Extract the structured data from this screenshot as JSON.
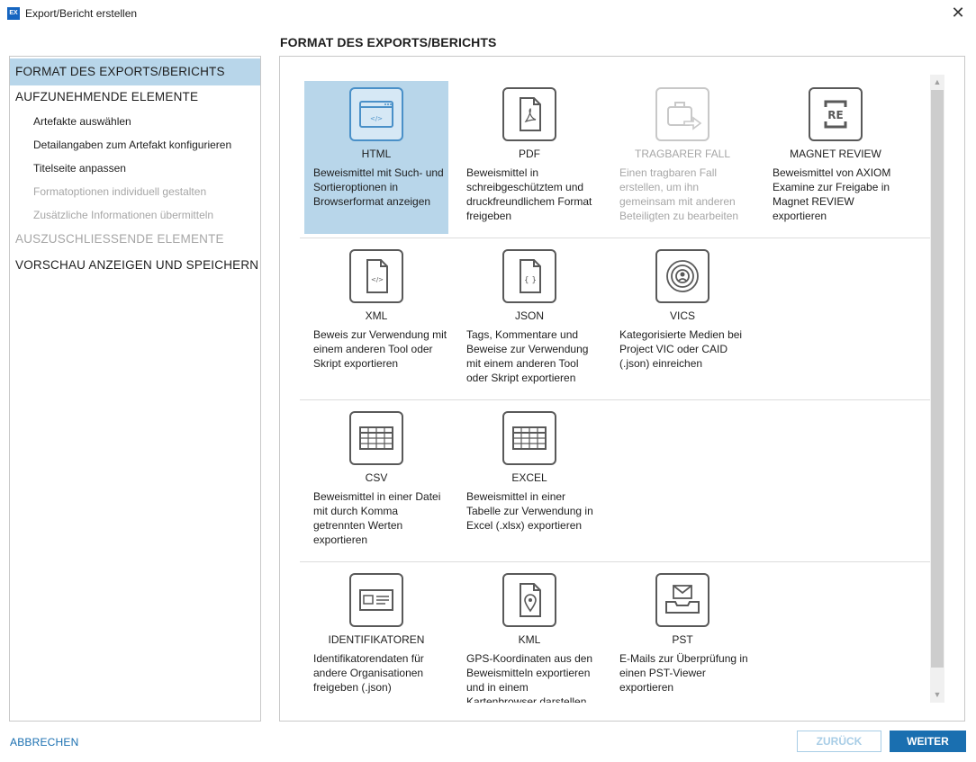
{
  "window": {
    "app_icon_text": "EX",
    "title": "Export/Bericht erstellen",
    "close": "✕"
  },
  "page_title": "FORMAT DES EXPORTS/BERICHTS",
  "sidebar": {
    "items": [
      {
        "label": "FORMAT DES EXPORTS/BERICHTS",
        "state": "active"
      },
      {
        "label": "AUFZUNEHMENDE ELEMENTE",
        "state": "normal"
      },
      {
        "label": "Artefakte auswählen",
        "state": "normal"
      },
      {
        "label": "Detailangaben zum Artefakt konfigurieren",
        "state": "normal"
      },
      {
        "label": "Titelseite anpassen",
        "state": "normal"
      },
      {
        "label": "Formatoptionen individuell gestalten",
        "state": "disabled"
      },
      {
        "label": "Zusätzliche Informationen übermitteln",
        "state": "disabled"
      },
      {
        "label": "AUSZUSCHLIESSENDE ELEMENTE",
        "state": "disabled"
      },
      {
        "label": "VORSCHAU ANZEIGEN UND SPEICHERN",
        "state": "normal"
      }
    ]
  },
  "formats": [
    {
      "label": "HTML",
      "description": "Beweismittel mit Such- und Sortieroptionen in Browserformat anzeigen",
      "icon": "html-browser-icon",
      "state": "selected"
    },
    {
      "label": "PDF",
      "description": "Beweismittel in schreibgeschütztem und druckfreundlichem Format freigeben",
      "icon": "pdf-document-icon",
      "state": "normal"
    },
    {
      "label": "TRAGBARER FALL",
      "description": "Einen tragbaren Fall erstellen, um ihn gemeinsam mit anderen Beteiligten zu bearbeiten",
      "icon": "portable-case-icon",
      "state": "disabled"
    },
    {
      "label": "MAGNET REVIEW",
      "description": "Beweismittel von AXIOM Examine zur Freigabe in Magnet REVIEW exportieren",
      "icon": "magnet-review-icon",
      "state": "normal"
    },
    {
      "label": "XML",
      "description": "Beweis zur Verwendung mit einem anderen Tool oder Skript exportieren",
      "icon": "xml-document-icon",
      "state": "normal"
    },
    {
      "label": "JSON",
      "description": "Tags, Kommentare und Beweise zur Verwendung mit einem anderen Tool oder Skript exportieren",
      "icon": "json-document-icon",
      "state": "normal"
    },
    {
      "label": "VICS",
      "description": "Kategorisierte Medien bei Project VIC oder CAID (.json) einreichen",
      "icon": "vics-fingerprint-icon",
      "state": "normal"
    },
    {
      "label": "CSV",
      "description": "Beweismittel in einer Datei mit durch Komma getrennten Werten exportieren",
      "icon": "csv-table-icon",
      "state": "normal"
    },
    {
      "label": "EXCEL",
      "description": "Beweismittel in einer Tabelle zur Verwendung in Excel (.xlsx) exportieren",
      "icon": "excel-table-icon",
      "state": "normal"
    },
    {
      "label": "IDENTIFIKATOREN",
      "description": "Identifikatorendaten für andere Organisationen freigeben (.json)",
      "icon": "id-card-icon",
      "state": "normal"
    },
    {
      "label": "KML",
      "description": "GPS-Koordinaten aus den Beweismitteln exportieren und in einem Kartenbrowser darstellen",
      "icon": "kml-map-pin-icon",
      "state": "normal"
    },
    {
      "label": "PST",
      "description": "E-Mails zur Überprüfung in einen PST-Viewer exportieren",
      "icon": "pst-mail-tray-icon",
      "state": "normal"
    }
  ],
  "footer": {
    "cancel_label": "ABBRECHEN",
    "back_label": "ZURÜCK",
    "next_label": "WEITER"
  },
  "colors": {
    "accent": "#1a6fb0",
    "selection": "#b8d6ea",
    "disabled_text": "#a6a6a6"
  }
}
